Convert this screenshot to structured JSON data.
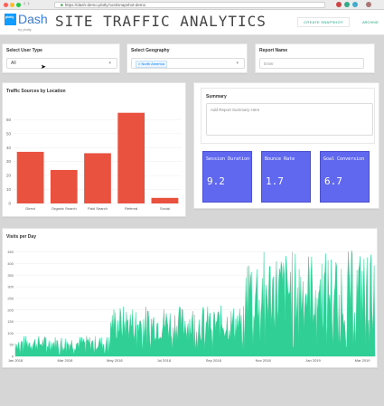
{
  "browser": {
    "url": "https://dash-demo.plotly.host/snapshot-demo",
    "secure_icon": "lock-icon",
    "traffic_lights": [
      "#fd5f57",
      "#fdbc2e",
      "#28c840"
    ]
  },
  "header": {
    "logo_text": "Dash",
    "logo_sub": "by plotly",
    "logo_mark": "plotly",
    "title": "SITE TRAFFIC ANALYTICS",
    "create_snapshot_label": "CREATE SNAPSHOT",
    "archive_label": "ARCHIVE"
  },
  "filters": {
    "user_type": {
      "label": "Select User Type",
      "value": "All"
    },
    "geography": {
      "label": "Select Geography",
      "chip": "North America"
    },
    "report_name": {
      "label": "Report Name",
      "placeholder": "Enter"
    }
  },
  "summary": {
    "label": "Summary",
    "placeholder": "Add Report Summary Here"
  },
  "metrics": [
    {
      "label": "Session Duration",
      "value": "9.2"
    },
    {
      "label": "Bounce Rate",
      "value": "1.7"
    },
    {
      "label": "Goal Conversion",
      "value": "6.7"
    }
  ],
  "colors": {
    "bar": "#e8523f",
    "metric": "#6168f0",
    "area": "#2fcf96",
    "accent": "#1aa07a"
  },
  "chart_data": [
    {
      "type": "bar",
      "title": "Traffic Sources by Location",
      "categories": [
        "Direct",
        "Organic Search",
        "Paid Search",
        "Referral",
        "Social"
      ],
      "values": [
        37,
        24,
        36,
        65,
        4
      ],
      "ylim": [
        0,
        70
      ],
      "yticks": [
        "0",
        "10",
        "20",
        "30",
        "40",
        "50",
        "60"
      ]
    },
    {
      "type": "area",
      "title": "Visits per Day",
      "x_tick_labels": [
        "Jan 2018",
        "Mar 2018",
        "May 2018",
        "Jul 2018",
        "Sep 2018",
        "Nov 2018",
        "Jan 2019",
        "Mar 2019"
      ],
      "yticks": [
        "0",
        "50",
        "100",
        "150",
        "200",
        "250",
        "300",
        "350",
        "400",
        "450"
      ],
      "ylim": [
        0,
        480
      ],
      "segments": [
        {
          "from": "Jan 2018",
          "to": "Apr 2018",
          "typical_min": 20,
          "typical_max": 90
        },
        {
          "from": "May 2018",
          "to": "Sep 2018",
          "typical_min": 60,
          "typical_max": 220
        },
        {
          "from": "Oct 2018",
          "to": "Apr 2019",
          "typical_min": 100,
          "typical_max": 460
        }
      ]
    }
  ]
}
